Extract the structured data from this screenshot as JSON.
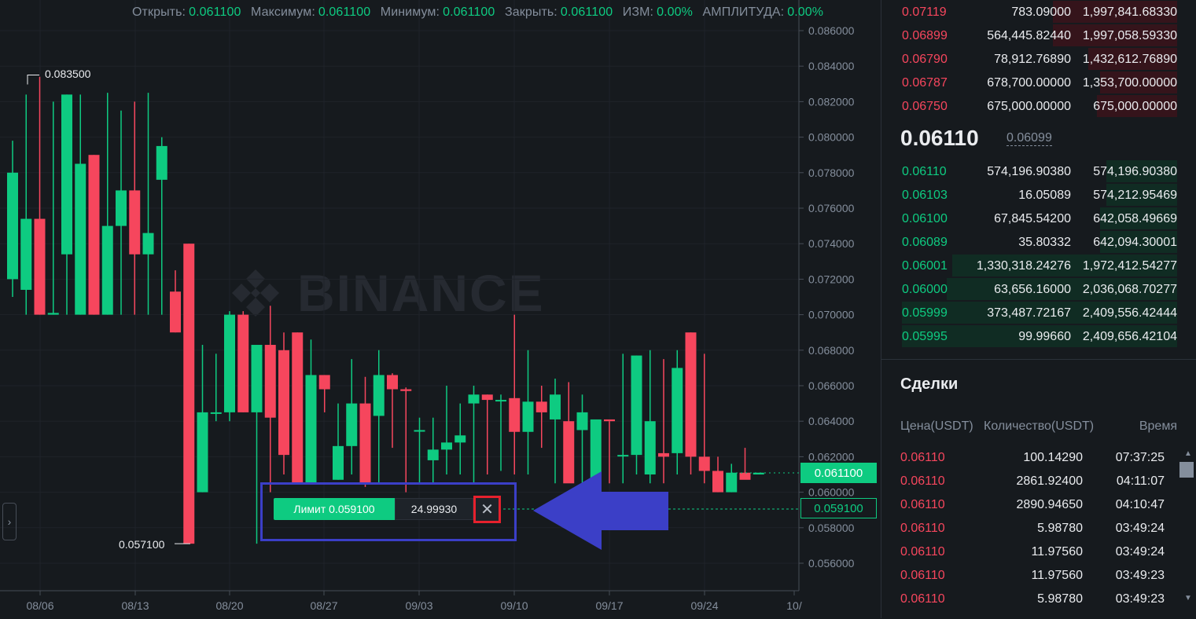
{
  "chart": {
    "ohlc": [
      {
        "label": "Открыть:",
        "value": "0.061100"
      },
      {
        "label": "Максимум:",
        "value": "0.061100"
      },
      {
        "label": "Минимум:",
        "value": "0.061100"
      },
      {
        "label": "Закрыть:",
        "value": "0.061100"
      },
      {
        "label": "ИЗМ:",
        "value": "0.00%"
      },
      {
        "label": "АМПЛИТУДА:",
        "value": "0.00%"
      }
    ],
    "watermark": "BINANCE",
    "high_label": "0.083500",
    "low_label": "0.057100",
    "last_price_tag": "0.061100",
    "limit_price_tag": "0.059100",
    "order": {
      "label": "Лимит 0.059100",
      "qty": "24.99930",
      "cancel": "✕"
    },
    "side_toggle": "›",
    "y_ticks": [
      "0.086000",
      "0.084000",
      "0.082000",
      "0.080000",
      "0.078000",
      "0.076000",
      "0.074000",
      "0.072000",
      "0.070000",
      "0.068000",
      "0.066000",
      "0.064000",
      "0.062000",
      "0.060000",
      "0.058000",
      "0.056000"
    ],
    "x_ticks": [
      "08/06",
      "08/13",
      "08/20",
      "08/27",
      "09/03",
      "09/10",
      "09/17",
      "09/24",
      "10/"
    ],
    "colors": {
      "up": "#0ecb81",
      "down": "#f6465d",
      "arrow": "#3b3fc7",
      "highlight": "#e6212d"
    }
  },
  "chart_data": {
    "type": "candlestick",
    "ylim": [
      0.055,
      0.0865
    ],
    "candles": [
      {
        "o": 0.072,
        "h": 0.0798,
        "l": 0.071,
        "c": 0.078
      },
      {
        "o": 0.0714,
        "h": 0.0824,
        "l": 0.07,
        "c": 0.0754
      },
      {
        "o": 0.0754,
        "h": 0.0834,
        "l": 0.07,
        "c": 0.07
      },
      {
        "o": 0.07,
        "h": 0.082,
        "l": 0.07,
        "c": 0.0701
      },
      {
        "o": 0.0734,
        "h": 0.0824,
        "l": 0.07,
        "c": 0.0824
      },
      {
        "o": 0.07,
        "h": 0.0824,
        "l": 0.07,
        "c": 0.0785
      },
      {
        "o": 0.079,
        "h": 0.079,
        "l": 0.07,
        "c": 0.07
      },
      {
        "o": 0.07,
        "h": 0.0825,
        "l": 0.07,
        "c": 0.075
      },
      {
        "o": 0.075,
        "h": 0.0815,
        "l": 0.07,
        "c": 0.077
      },
      {
        "o": 0.077,
        "h": 0.082,
        "l": 0.07,
        "c": 0.0734
      },
      {
        "o": 0.0734,
        "h": 0.0825,
        "l": 0.07,
        "c": 0.0746
      },
      {
        "o": 0.0776,
        "h": 0.08,
        "l": 0.07,
        "c": 0.0795
      },
      {
        "o": 0.0713,
        "h": 0.0725,
        "l": 0.069,
        "c": 0.069
      },
      {
        "o": 0.074,
        "h": 0.074,
        "l": 0.0571,
        "c": 0.0571
      },
      {
        "o": 0.06,
        "h": 0.0683,
        "l": 0.06,
        "c": 0.0645
      },
      {
        "o": 0.0645,
        "h": 0.0678,
        "l": 0.064,
        "c": 0.0645
      },
      {
        "o": 0.0645,
        "h": 0.0702,
        "l": 0.064,
        "c": 0.07
      },
      {
        "o": 0.07,
        "h": 0.0702,
        "l": 0.0645,
        "c": 0.0645
      },
      {
        "o": 0.0645,
        "h": 0.0682,
        "l": 0.0571,
        "c": 0.0683
      },
      {
        "o": 0.0683,
        "h": 0.0705,
        "l": 0.06,
        "c": 0.0642
      },
      {
        "o": 0.068,
        "h": 0.069,
        "l": 0.061,
        "c": 0.0621
      },
      {
        "o": 0.069,
        "h": 0.069,
        "l": 0.0605,
        "c": 0.0605
      },
      {
        "o": 0.0605,
        "h": 0.0686,
        "l": 0.0605,
        "c": 0.0666
      },
      {
        "o": 0.0666,
        "h": 0.0666,
        "l": 0.0645,
        "c": 0.0658
      },
      {
        "o": 0.0607,
        "h": 0.065,
        "l": 0.0607,
        "c": 0.0626
      },
      {
        "o": 0.0626,
        "h": 0.0675,
        "l": 0.061,
        "c": 0.065
      },
      {
        "o": 0.065,
        "h": 0.0665,
        "l": 0.0603,
        "c": 0.0605
      },
      {
        "o": 0.0643,
        "h": 0.068,
        "l": 0.0605,
        "c": 0.0666
      },
      {
        "o": 0.0666,
        "h": 0.0667,
        "l": 0.0625,
        "c": 0.0658
      },
      {
        "o": 0.0658,
        "h": 0.0659,
        "l": 0.06,
        "c": 0.0657
      },
      {
        "o": 0.0635,
        "h": 0.0642,
        "l": 0.0605,
        "c": 0.0635
      },
      {
        "o": 0.0618,
        "h": 0.0642,
        "l": 0.0605,
        "c": 0.0624
      },
      {
        "o": 0.0624,
        "h": 0.066,
        "l": 0.061,
        "c": 0.0628
      },
      {
        "o": 0.0628,
        "h": 0.065,
        "l": 0.061,
        "c": 0.0632
      },
      {
        "o": 0.065,
        "h": 0.066,
        "l": 0.0605,
        "c": 0.0655
      },
      {
        "o": 0.0655,
        "h": 0.0655,
        "l": 0.061,
        "c": 0.0652
      },
      {
        "o": 0.0652,
        "h": 0.0655,
        "l": 0.0612,
        "c": 0.0652
      },
      {
        "o": 0.0653,
        "h": 0.07,
        "l": 0.061,
        "c": 0.0634
      },
      {
        "o": 0.0634,
        "h": 0.068,
        "l": 0.061,
        "c": 0.0651
      },
      {
        "o": 0.0651,
        "h": 0.066,
        "l": 0.0625,
        "c": 0.0645
      },
      {
        "o": 0.0641,
        "h": 0.0664,
        "l": 0.0605,
        "c": 0.0655
      },
      {
        "o": 0.064,
        "h": 0.0662,
        "l": 0.061,
        "c": 0.0605
      },
      {
        "o": 0.0635,
        "h": 0.0655,
        "l": 0.0605,
        "c": 0.0645
      },
      {
        "o": 0.0605,
        "h": 0.064,
        "l": 0.06,
        "c": 0.0641
      },
      {
        "o": 0.0641,
        "h": 0.064,
        "l": 0.0605,
        "c": 0.064
      },
      {
        "o": 0.0621,
        "h": 0.0678,
        "l": 0.0605,
        "c": 0.0621
      },
      {
        "o": 0.0621,
        "h": 0.0677,
        "l": 0.061,
        "c": 0.0677
      },
      {
        "o": 0.061,
        "h": 0.068,
        "l": 0.0605,
        "c": 0.064
      },
      {
        "o": 0.0622,
        "h": 0.0675,
        "l": 0.0605,
        "c": 0.062
      },
      {
        "o": 0.0622,
        "h": 0.068,
        "l": 0.061,
        "c": 0.067
      },
      {
        "o": 0.069,
        "h": 0.069,
        "l": 0.061,
        "c": 0.062
      },
      {
        "o": 0.062,
        "h": 0.0678,
        "l": 0.0605,
        "c": 0.0612
      },
      {
        "o": 0.0612,
        "h": 0.062,
        "l": 0.06,
        "c": 0.06
      },
      {
        "o": 0.06,
        "h": 0.0616,
        "l": 0.06,
        "c": 0.0611
      },
      {
        "o": 0.0611,
        "h": 0.0625,
        "l": 0.0608,
        "c": 0.0607
      },
      {
        "o": 0.061,
        "h": 0.061,
        "l": 0.061,
        "c": 0.0611
      }
    ]
  },
  "order_book": {
    "asks": [
      {
        "price": "0.07119",
        "amount": "783.09000",
        "total": "1,997,841.68330",
        "depth": 0.42
      },
      {
        "price": "0.06899",
        "amount": "564,445.82440",
        "total": "1,997,058.59330",
        "depth": 0.42
      },
      {
        "price": "0.06790",
        "amount": "78,912.76890",
        "total": "1,432,612.76890",
        "depth": 0.3
      },
      {
        "price": "0.06787",
        "amount": "678,700.00000",
        "total": "1,353,700.00000",
        "depth": 0.26
      },
      {
        "price": "0.06750",
        "amount": "675,000.00000",
        "total": "675,000.00000",
        "depth": 0.27
      }
    ],
    "mid_price": "0.06110",
    "mark_price": "0.06099",
    "bids": [
      {
        "price": "0.06110",
        "amount": "574,196.90380",
        "total": "574,196.90380",
        "depth": 0.24
      },
      {
        "price": "0.06103",
        "amount": "16.05089",
        "total": "574,212.95469",
        "depth": 0.24
      },
      {
        "price": "0.06100",
        "amount": "67,845.54200",
        "total": "642,058.49669",
        "depth": 0.26
      },
      {
        "price": "0.06089",
        "amount": "35.80332",
        "total": "642,094.30001",
        "depth": 0.26
      },
      {
        "price": "0.06001",
        "amount": "1,330,318.24276",
        "total": "1,972,412.54277",
        "depth": 0.76
      },
      {
        "price": "0.06000",
        "amount": "63,656.16000",
        "total": "2,036,068.70277",
        "depth": 0.78
      },
      {
        "price": "0.05999",
        "amount": "373,487.72167",
        "total": "2,409,556.42444",
        "depth": 0.93
      },
      {
        "price": "0.05995",
        "amount": "99.99660",
        "total": "2,409,656.42104",
        "depth": 0.93
      }
    ]
  },
  "trades": {
    "title": "Сделки",
    "headers": {
      "price": "Цена(USDT)",
      "qty": "Количество(USDT)",
      "time": "Время"
    },
    "rows": [
      {
        "price": "0.06110",
        "qty": "100.14290",
        "time": "07:37:25"
      },
      {
        "price": "0.06110",
        "qty": "2861.92400",
        "time": "04:11:07"
      },
      {
        "price": "0.06110",
        "qty": "2890.94650",
        "time": "04:10:47"
      },
      {
        "price": "0.06110",
        "qty": "5.98780",
        "time": "03:49:24"
      },
      {
        "price": "0.06110",
        "qty": "11.97560",
        "time": "03:49:24"
      },
      {
        "price": "0.06110",
        "qty": "11.97560",
        "time": "03:49:23"
      },
      {
        "price": "0.06110",
        "qty": "5.98780",
        "time": "03:49:23"
      }
    ]
  }
}
